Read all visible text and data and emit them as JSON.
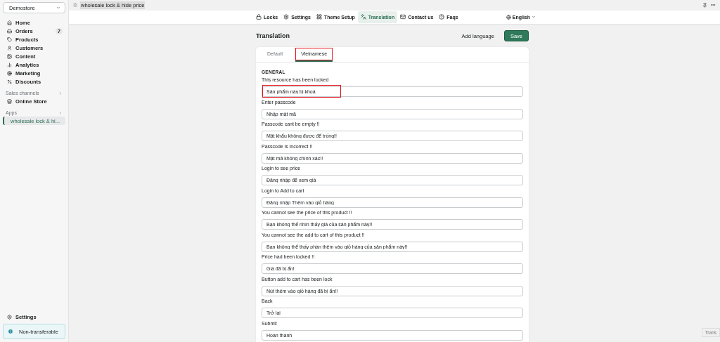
{
  "store_switcher": {
    "label": "Demostore"
  },
  "sidebar": {
    "items": [
      {
        "label": "Home",
        "selected": false
      },
      {
        "label": "Orders",
        "badge": "7",
        "selected": false
      },
      {
        "label": "Products",
        "selected": false
      },
      {
        "label": "Customers",
        "selected": false
      },
      {
        "label": "Content",
        "selected": false
      },
      {
        "label": "Analytics",
        "selected": false
      },
      {
        "label": "Marketing",
        "selected": false
      },
      {
        "label": "Discounts",
        "selected": false
      }
    ],
    "sales_channels": {
      "heading": "Sales channels",
      "items": [
        {
          "label": "Online Store",
          "selected": false
        }
      ]
    },
    "apps": {
      "heading": "Apps",
      "items": [
        {
          "label": "wholesale lock & hi...",
          "selected": true
        }
      ]
    },
    "settings": "Settings",
    "notice": "Non-transferable"
  },
  "app_header": {
    "title": "wholesale lock & hide price"
  },
  "nav": {
    "items": [
      {
        "label": "Locks",
        "selected": false
      },
      {
        "label": "Settings",
        "selected": false
      },
      {
        "label": "Theme Setup",
        "selected": false
      },
      {
        "label": "Translation",
        "selected": true
      },
      {
        "label": "Contact us",
        "selected": false
      },
      {
        "label": "Faqs",
        "selected": false
      }
    ],
    "language": "English"
  },
  "page": {
    "title": "Translation",
    "add_language": "Add language",
    "save": "Save"
  },
  "tabs": [
    {
      "label": "Default",
      "selected": false,
      "highlighted": false
    },
    {
      "label": "Vietnamese",
      "selected": true,
      "highlighted": true
    }
  ],
  "section_heading": "GENERAL",
  "fields": [
    {
      "label": "This resource has been locked",
      "value": "Sản phẩm này bị khoá",
      "highlighted": true
    },
    {
      "label": "Enter passcode",
      "value": "Nhập mật mã",
      "highlighted": false
    },
    {
      "label": "Passcode cant be empty !!",
      "value": "Mật khẩu không được để trống!!",
      "highlighted": false
    },
    {
      "label": "Passcode is incorrect !!",
      "value": "Mật mã không chính xác!!",
      "highlighted": false
    },
    {
      "label": "Login to see price",
      "value": "Đăng nhập để xem giá",
      "highlighted": false
    },
    {
      "label": "Login to Add to cart",
      "value": "Đăng nhập Thêm vào giỏ hàng",
      "highlighted": false
    },
    {
      "label": "You cannot see the price of this product !!",
      "value": "Bạn không thể nhìn thấy giá của sản phẩm này!!",
      "highlighted": false
    },
    {
      "label": "You cannot see the add to cart of this product !!",
      "value": "Bạn không thể thấy phần thêm vào giỏ hàng của sản phẩm này!!",
      "highlighted": false
    },
    {
      "label": "Price had been locked !!",
      "value": "Giá đã bị ẩn!",
      "highlighted": false
    },
    {
      "label": "Button add to cart has been lock",
      "value": "Nút thêm vào giỏ hàng đã bị ẩn!!",
      "highlighted": false
    },
    {
      "label": "Back",
      "value": "Trở lại",
      "highlighted": false
    },
    {
      "label": "Submit",
      "value": "Hoàn thành",
      "highlighted": false
    }
  ],
  "corner_tooltip": "Trans"
}
